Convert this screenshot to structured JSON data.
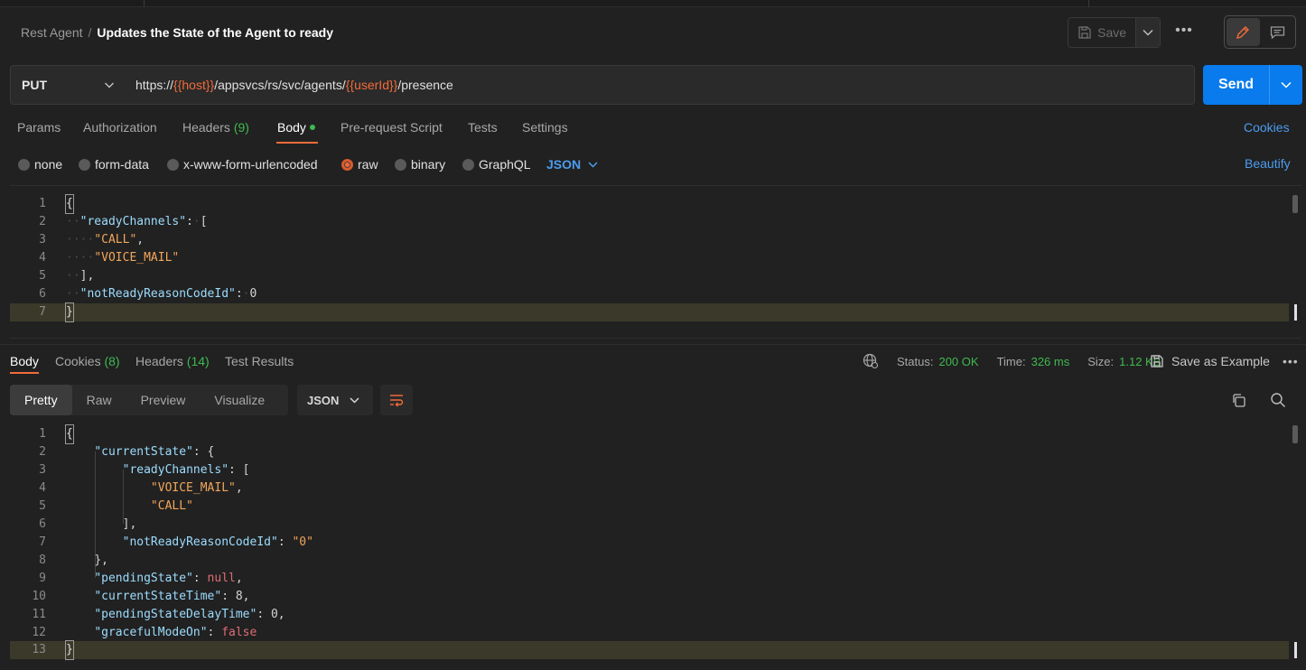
{
  "header": {
    "breadcrumb_parent": "Rest Agent",
    "breadcrumb_separator": "/",
    "title": "Updates the State of the Agent to ready",
    "save_label": "Save",
    "more_label": "•••"
  },
  "request": {
    "method": "PUT",
    "url_parts": {
      "p1": "https://",
      "v1": "{{host}}",
      "p2": "/appsvcs/rs/svc/agents/",
      "v2": "{{userId}}",
      "p3": "/presence"
    },
    "send_label": "Send"
  },
  "request_tabs": {
    "params": "Params",
    "authorization": "Authorization",
    "headers": "Headers",
    "headers_count": "(9)",
    "body": "Body",
    "pre_request": "Pre-request Script",
    "tests": "Tests",
    "settings": "Settings",
    "cookies": "Cookies"
  },
  "body_types": {
    "none": "none",
    "form_data": "form-data",
    "urlencoded": "x-www-form-urlencoded",
    "raw": "raw",
    "binary": "binary",
    "graphql": "GraphQL",
    "format": "JSON",
    "beautify": "Beautify",
    "selected": "raw"
  },
  "request_body_lines": [
    {
      "n": "1",
      "t": "{"
    },
    {
      "n": "2",
      "t": "\"readyChannels\": ["
    },
    {
      "n": "3",
      "t": "\"CALL\","
    },
    {
      "n": "4",
      "t": "\"VOICE_MAIL\""
    },
    {
      "n": "5",
      "t": "],"
    },
    {
      "n": "6",
      "t": "\"notReadyReasonCodeId\": 0"
    },
    {
      "n": "7",
      "t": "}"
    }
  ],
  "response_tabs": {
    "body": "Body",
    "cookies": "Cookies",
    "cookies_count": "(8)",
    "headers": "Headers",
    "headers_count": "(14)",
    "test_results": "Test Results"
  },
  "response_status": {
    "status_label": "Status:",
    "status_value": "200 OK",
    "time_label": "Time:",
    "time_value": "326 ms",
    "size_label": "Size:",
    "size_value": "1.12 KB",
    "save_example": "Save as Example",
    "more_label": "•••"
  },
  "response_view": {
    "pretty": "Pretty",
    "raw": "Raw",
    "preview": "Preview",
    "visualize": "Visualize",
    "format": "JSON",
    "selected": "Pretty"
  },
  "response_body_lines": [
    {
      "n": "1",
      "t": "{"
    },
    {
      "n": "2",
      "t": "\"currentState\": {"
    },
    {
      "n": "3",
      "t": "\"readyChannels\": ["
    },
    {
      "n": "4",
      "t": "\"VOICE_MAIL\","
    },
    {
      "n": "5",
      "t": "\"CALL\""
    },
    {
      "n": "6",
      "t": "],"
    },
    {
      "n": "7",
      "t": "\"notReadyReasonCodeId\": \"0\""
    },
    {
      "n": "8",
      "t": "},"
    },
    {
      "n": "9",
      "t": "\"pendingState\": null,"
    },
    {
      "n": "10",
      "t": "\"currentStateTime\": 8,"
    },
    {
      "n": "11",
      "t": "\"pendingStateDelayTime\": 0,"
    },
    {
      "n": "12",
      "t": "\"gracefulModeOn\": false"
    },
    {
      "n": "13",
      "t": "}"
    }
  ],
  "colors": {
    "accent": "#f26b3a",
    "send": "#097bed",
    "link": "#4c9cf0",
    "success": "#3fb950",
    "json_key": "#9cdcfe",
    "json_string": "#f2a65a"
  },
  "icons": {
    "save": "save-icon",
    "caret": "chevron-down-icon",
    "edit": "pencil-icon",
    "comment": "comment-icon",
    "globe": "globe-icon",
    "save_example": "save-icon",
    "wrap": "wrap-lines-icon",
    "copy": "copy-icon",
    "search": "search-icon"
  }
}
